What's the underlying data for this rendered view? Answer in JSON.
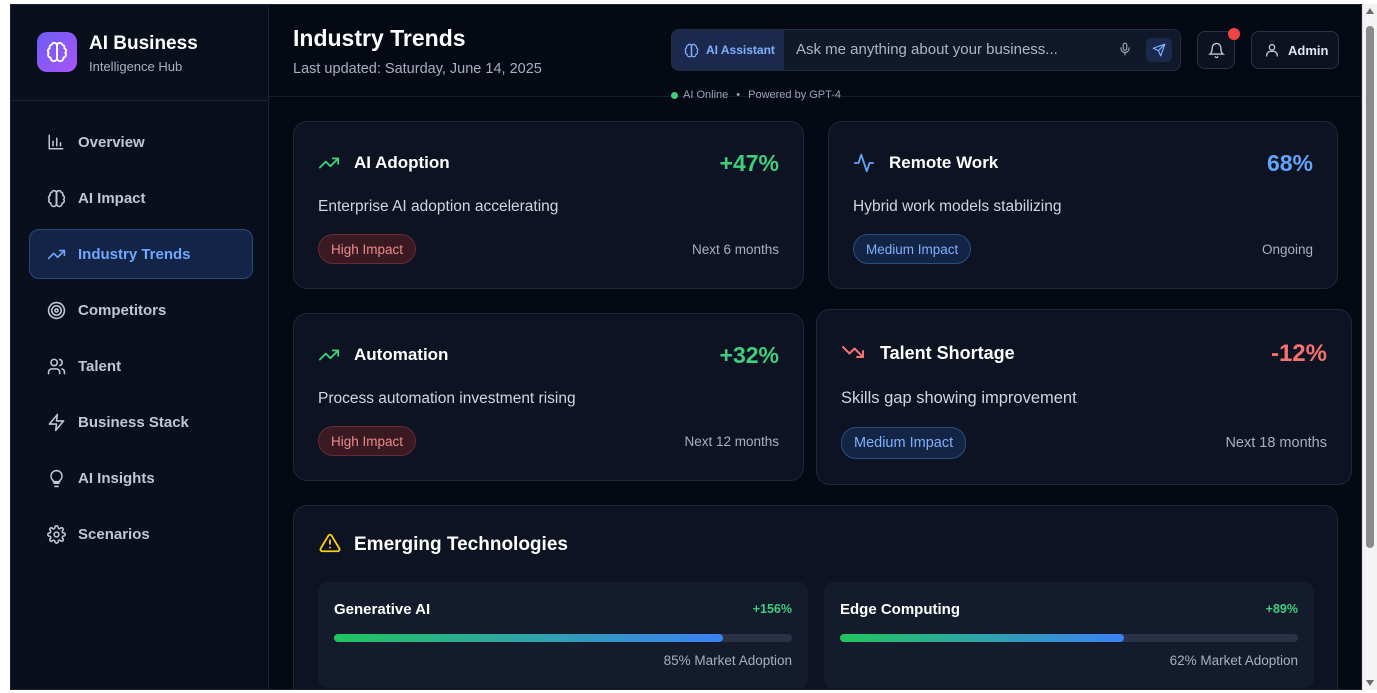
{
  "brand": {
    "title": "AI Business",
    "subtitle": "Intelligence Hub"
  },
  "sidebar": {
    "items": [
      {
        "label": "Overview",
        "icon": "bar-chart-icon",
        "active": false
      },
      {
        "label": "AI Impact",
        "icon": "brain-icon",
        "active": false
      },
      {
        "label": "Industry Trends",
        "icon": "trending-up-icon",
        "active": true
      },
      {
        "label": "Competitors",
        "icon": "target-icon",
        "active": false
      },
      {
        "label": "Talent",
        "icon": "users-icon",
        "active": false
      },
      {
        "label": "Business Stack",
        "icon": "zap-icon",
        "active": false
      },
      {
        "label": "AI Insights",
        "icon": "lightbulb-icon",
        "active": false
      },
      {
        "label": "Scenarios",
        "icon": "gear-icon",
        "active": false
      }
    ]
  },
  "header": {
    "title": "Industry Trends",
    "subtitle": "Last updated: Saturday, June 14, 2025",
    "assistant": {
      "badge": "AI Assistant",
      "placeholder": "Ask me anything about your business...",
      "status": "AI Online",
      "separator": "•",
      "powered": "Powered by GPT-4"
    },
    "user": "Admin"
  },
  "trends": [
    {
      "title": "AI Adoption",
      "value": "+47%",
      "description": "Enterprise AI adoption accelerating",
      "impact": "High Impact",
      "timeframe": "Next 6 months",
      "icon": "trending-up-icon",
      "tone": "green"
    },
    {
      "title": "Remote Work",
      "value": "68%",
      "description": "Hybrid work models stabilizing",
      "impact": "Medium Impact",
      "timeframe": "Ongoing",
      "icon": "activity-icon",
      "tone": "blue"
    },
    {
      "title": "Automation",
      "value": "+32%",
      "description": "Process automation investment rising",
      "impact": "High Impact",
      "timeframe": "Next 12 months",
      "icon": "trending-up-icon",
      "tone": "green"
    },
    {
      "title": "Talent Shortage",
      "value": "-12%",
      "description": "Skills gap showing improvement",
      "impact": "Medium Impact",
      "timeframe": "Next 18 months",
      "icon": "trending-down-icon",
      "tone": "red"
    }
  ],
  "emerging": {
    "title": "Emerging Technologies",
    "items": [
      {
        "name": "Generative AI",
        "growth": "+156%",
        "adoption": "85% Market Adoption",
        "adoption_pct": 85
      },
      {
        "name": "Edge Computing",
        "growth": "+89%",
        "adoption": "62% Market Adoption",
        "adoption_pct": 62
      }
    ]
  },
  "colors": {
    "accent": "#3b82f6",
    "positive": "#3fcf7c",
    "negative": "#f87171",
    "background": "#050914"
  }
}
